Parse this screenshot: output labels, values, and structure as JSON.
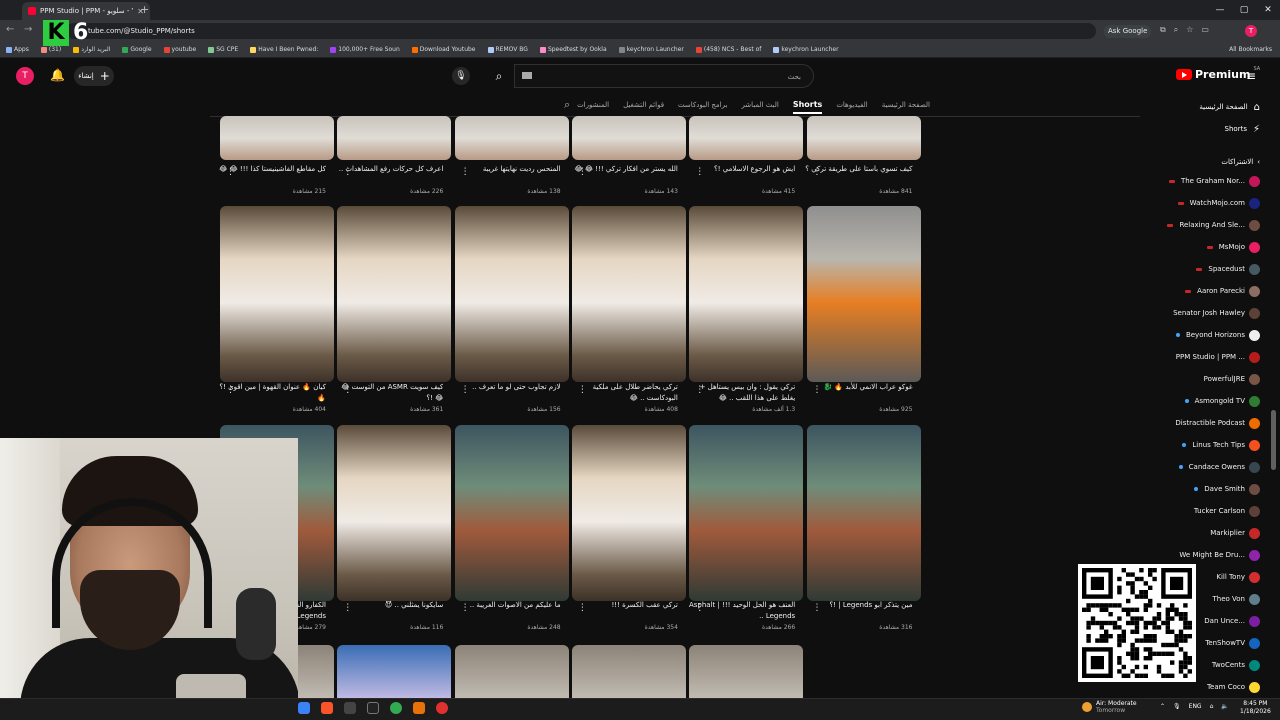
{
  "browser": {
    "tab_title": "PPM Studio | PPM - سلويو - You",
    "url": "tube.com/@Studio_PPM/shorts",
    "ask_google": "Ask Google",
    "all_bookmarks": "All Bookmarks",
    "bookmarks": [
      "Apps",
      "(31)",
      "البريد الوارد",
      "Google",
      "youtube",
      "SG CPE",
      "Have I Been Pwned:",
      "100,000+ Free Soun",
      "Download Youtube",
      "REMOV BG",
      "Speedtest by Ookla",
      "keychron Launcher",
      "(458) NCS - Best of",
      "keychron Launcher"
    ]
  },
  "overlay": {
    "k": "K",
    "six": "6"
  },
  "youtube": {
    "avatar_letter": "T",
    "create_label": "إنشاء",
    "search_placeholder": "بحث",
    "logo_text": "Premium",
    "logo_region": "SA"
  },
  "channel_tabs": [
    "المنشورات",
    "قوائم التشغيل",
    "برامج البودكاست",
    "البث المباشر",
    "Shorts",
    "الفيديوهات",
    "الصفحة الرئيسية"
  ],
  "sidebar": {
    "home": "الصفحة الرئيسية",
    "shorts": "Shorts",
    "subs_title": "الاشتراكات",
    "subscriptions": [
      {
        "name": "The Graham Nor...",
        "mark": "red",
        "color": "#c2185b"
      },
      {
        "name": "WatchMojo.com",
        "mark": "red",
        "color": "#1a237e"
      },
      {
        "name": "Relaxing And Sle...",
        "mark": "red",
        "color": "#6d4c41"
      },
      {
        "name": "MsMojo",
        "mark": "red",
        "color": "#e91e63"
      },
      {
        "name": "Spacedust",
        "mark": "red",
        "color": "#455a64"
      },
      {
        "name": "Aaron Parecki",
        "mark": "red",
        "color": "#8d6e63"
      },
      {
        "name": "Senator Josh Hawley",
        "mark": "",
        "color": "#5d4037"
      },
      {
        "name": "Beyond Horizons",
        "mark": "blue",
        "color": "#eeeeee"
      },
      {
        "name": "PPM Studio | PPM ...",
        "mark": "",
        "color": "#b71c1c"
      },
      {
        "name": "PowerfulJRE",
        "mark": "",
        "color": "#795548"
      },
      {
        "name": "Asmongold TV",
        "mark": "blue",
        "color": "#2e7d32"
      },
      {
        "name": "Distractible Podcast",
        "mark": "",
        "color": "#ef6c00"
      },
      {
        "name": "Linus Tech Tips",
        "mark": "blue",
        "color": "#f4511e"
      },
      {
        "name": "Candace Owens",
        "mark": "blue",
        "color": "#37474f"
      },
      {
        "name": "Dave Smith",
        "mark": "blue",
        "color": "#6d4c41"
      },
      {
        "name": "Tucker Carlson",
        "mark": "",
        "color": "#5d4037"
      },
      {
        "name": "Markiplier",
        "mark": "",
        "color": "#c62828"
      },
      {
        "name": "We Might Be Dru...",
        "mark": "",
        "color": "#8e24aa"
      },
      {
        "name": "Kill Tony",
        "mark": "",
        "color": "#d32f2f"
      },
      {
        "name": "Theo Von",
        "mark": "",
        "color": "#607d8b"
      },
      {
        "name": "Dan Unce...",
        "mark": "",
        "color": "#7b1fa2"
      },
      {
        "name": "TenShowTV",
        "mark": "",
        "color": "#1565c0"
      },
      {
        "name": "TwoCents",
        "mark": "",
        "color": "#00897b"
      },
      {
        "name": "Team Coco",
        "mark": "",
        "color": "#fdd835"
      }
    ]
  },
  "videos": [
    {
      "title": "كيف تسوي باستا على طريقة تركي ؟",
      "views": "841 مشاهدة",
      "theme": "hand"
    },
    {
      "title": "ايش هو الرجوع الاسلامي !؟",
      "views": "415 مشاهدة",
      "theme": "hand"
    },
    {
      "title": "الله يستر من افكار تركي !!! 😂 😂",
      "views": "143 مشاهدة",
      "theme": "hand"
    },
    {
      "title": "المنحس رديت نهايتها غريبة",
      "views": "138 مشاهدة",
      "theme": "hand"
    },
    {
      "title": "اعرف كل حركات رفع المشاهدات ..",
      "views": "226 مشاهدة",
      "theme": "hand"
    },
    {
      "title": "كل مقاطع الفاشينيستا كذا !!! 😂 😂",
      "views": "215 مشاهدة",
      "theme": "hand"
    },
    {
      "title": "غوكو عراب الانمي للأبد 🔥 🐉",
      "views": "925 مشاهدة",
      "theme": "orange"
    },
    {
      "title": "تركي يقول : وان بيس يستاهل + يغلط على هذا اللقب .. 😂",
      "views": "1.3 ألف مشاهدة",
      "theme": "studio"
    },
    {
      "title": "تركي يحاضر طلال على ملكية البودكاست .. 😂",
      "views": "408 مشاهدة",
      "theme": "studio"
    },
    {
      "title": "لازم تجاوب حتى لو ما تعرف ..",
      "views": "156 مشاهدة",
      "theme": "studio"
    },
    {
      "title": "كيف سويت ASMR من التوست 😂 😂 !؟",
      "views": "361 مشاهدة",
      "theme": "studio"
    },
    {
      "title": "كيان 🔥 عنوان القهوة | مين اقوى !؟ 🔥",
      "views": "404 مشاهدة",
      "theme": "studio"
    },
    {
      "title": "مين يتذكر ابو Legends | !؟",
      "views": "316 مشاهدة",
      "theme": "race"
    },
    {
      "title": "العنف هو الحل الوحيد !!! | Asphalt Legends ..",
      "views": "266 مشاهدة",
      "theme": "race"
    },
    {
      "title": "تركي عقب الكسرة !!!",
      "views": "354 مشاهدة",
      "theme": "studio"
    },
    {
      "title": "ما عليكم من الاصوات الغريبة ..",
      "views": "248 مشاهدة",
      "theme": "race"
    },
    {
      "title": "سايكونا يمثلني .. 😈",
      "views": "116 مشاهدة",
      "theme": "studio"
    },
    {
      "title": "الكفارو الشلتي !!! | Asphalt Legends ..",
      "views": "279 مشاهدة",
      "theme": "race"
    }
  ],
  "taskbar": {
    "weather_title": "Air: Moderate",
    "weather_sub": "Tomorrow",
    "lang": "ENG",
    "time": "8:45 PM",
    "date": "1/18/2026"
  }
}
